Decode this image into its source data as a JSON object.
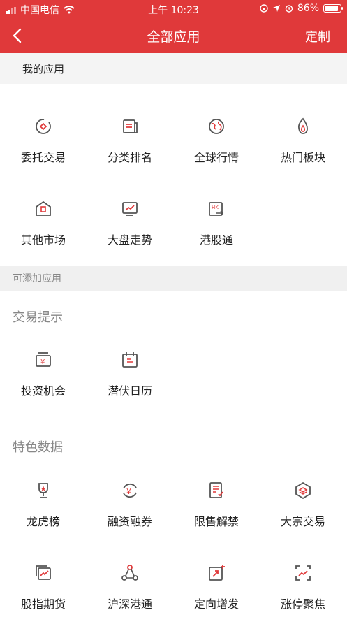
{
  "status_bar": {
    "carrier": "中国电信",
    "time": "上午 10:23",
    "battery": "86%",
    "battery_level": 0.86
  },
  "nav": {
    "title": "全部应用",
    "action": "定制"
  },
  "my_apps": {
    "heading": "我的应用",
    "items": [
      {
        "label": "委托交易",
        "icon": "trade-icon"
      },
      {
        "label": "分类排名",
        "icon": "ranking-icon"
      },
      {
        "label": "全球行情",
        "icon": "globe-icon"
      },
      {
        "label": "热门板块",
        "icon": "flame-icon"
      },
      {
        "label": "其他市场",
        "icon": "market-icon"
      },
      {
        "label": "大盘走势",
        "icon": "trend-icon"
      },
      {
        "label": "港股通",
        "icon": "hk-icon"
      }
    ]
  },
  "addable": {
    "heading": "可添加应用",
    "groups": [
      {
        "title": "交易提示",
        "items": [
          {
            "label": "投资机会",
            "icon": "opportunity-icon"
          },
          {
            "label": "潜伏日历",
            "icon": "calendar-icon"
          }
        ]
      },
      {
        "title": "特色数据",
        "items": [
          {
            "label": "龙虎榜",
            "icon": "trophy-icon"
          },
          {
            "label": "融资融券",
            "icon": "margin-icon"
          },
          {
            "label": "限售解禁",
            "icon": "unlock-icon"
          },
          {
            "label": "大宗交易",
            "icon": "block-trade-icon"
          },
          {
            "label": "股指期货",
            "icon": "futures-icon"
          },
          {
            "label": "沪深港通",
            "icon": "connect-icon"
          },
          {
            "label": "定向增发",
            "icon": "placement-icon"
          },
          {
            "label": "涨停聚焦",
            "icon": "limit-up-icon"
          }
        ]
      }
    ]
  },
  "colors": {
    "brand_red": "#e0393a",
    "icon_gray": "#555555"
  }
}
